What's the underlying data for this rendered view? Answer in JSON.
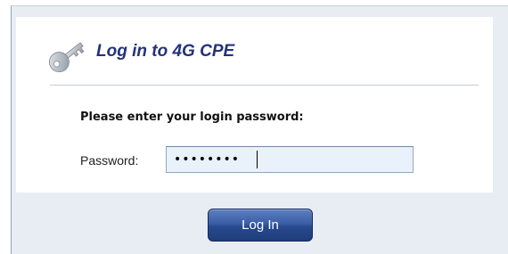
{
  "login": {
    "title": "Log in to 4G CPE",
    "instruction": "Please enter your login password:",
    "password_label": "Password:",
    "password_masked": "••••••••",
    "button_label": "Log In"
  },
  "icons": {
    "title_icon": "key-icon"
  },
  "colors": {
    "title": "#23327a",
    "button": "#2c4b8e",
    "panel_background": "#e8edf3",
    "field_background": "#e9f1fb"
  }
}
